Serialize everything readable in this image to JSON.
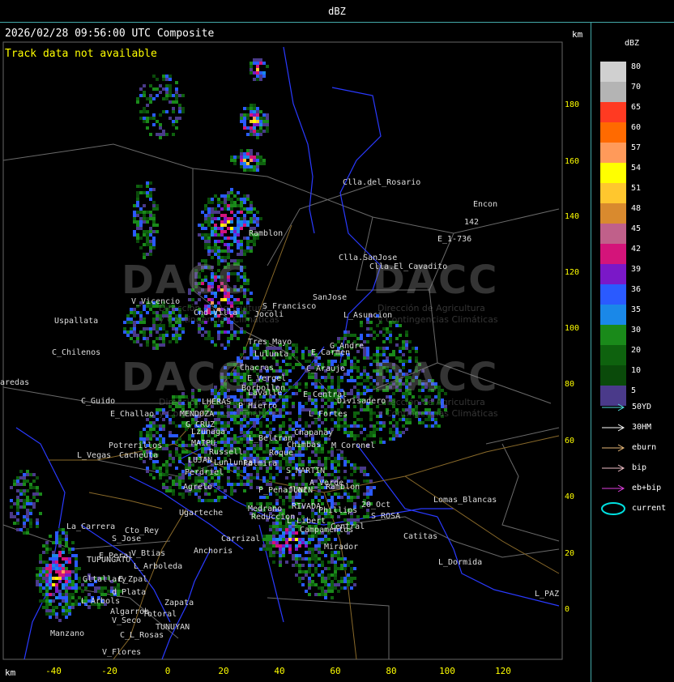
{
  "window_title": "dBZ",
  "header": {
    "timestamp": "2026/02/28 09:56:00 UTC Composite",
    "track_status": "Track data not available",
    "km_label_top": "km",
    "km_label_bottom": "km"
  },
  "axes": {
    "y_ticks": [
      "180",
      "160",
      "140",
      "120",
      "100",
      "80",
      "60",
      "40",
      "20",
      "0"
    ],
    "x_ticks": [
      "-40",
      "-20",
      "0",
      "20",
      "40",
      "60",
      "80",
      "100",
      "120"
    ]
  },
  "legend": {
    "title": "dBZ",
    "entries": [
      {
        "label": "80",
        "color": "#d0d0d0"
      },
      {
        "label": "70",
        "color": "#b4b4b4"
      },
      {
        "label": "65",
        "color": "#ff3a22"
      },
      {
        "label": "60",
        "color": "#ff6a00"
      },
      {
        "label": "57",
        "color": "#ff9a5a"
      },
      {
        "label": "54",
        "color": "#ffff00"
      },
      {
        "label": "51",
        "color": "#ffc72e"
      },
      {
        "label": "48",
        "color": "#d98a2e"
      },
      {
        "label": "45",
        "color": "#c0608a"
      },
      {
        "label": "42",
        "color": "#d4147a"
      },
      {
        "label": "39",
        "color": "#7a18c8"
      },
      {
        "label": "36",
        "color": "#2a5aff"
      },
      {
        "label": "35",
        "color": "#1a88e8"
      },
      {
        "label": "30",
        "color": "#1a8a1a"
      },
      {
        "label": "20",
        "color": "#0e620e"
      },
      {
        "label": "10",
        "color": "#0a4a0a"
      },
      {
        "label": "5",
        "color": "#4a3a8a"
      }
    ],
    "tracks": [
      {
        "label": "50YD",
        "color": "#55dddd"
      },
      {
        "label": "30HM",
        "color": "#ffffff"
      },
      {
        "label": "eburn",
        "color": "#e8b878"
      },
      {
        "label": "bip",
        "color": "#f0c0c8"
      },
      {
        "label": "eb+bip",
        "color": "#e040e0"
      },
      {
        "label": "current",
        "color": "#00e0e0"
      }
    ]
  },
  "watermark": {
    "brand": "DACC",
    "line1": "Dirección de Agricultura",
    "line2": "y Contingencias Climáticas"
  },
  "places": [
    {
      "name": "Clla.del_Rosario"
    },
    {
      "name": "Encon"
    },
    {
      "name": "142"
    },
    {
      "name": "E_1-736"
    },
    {
      "name": "Clla.SanJose"
    },
    {
      "name": "Clla.El_Cavadito"
    },
    {
      "name": "Ramblon"
    },
    {
      "name": "V_Vicencio"
    },
    {
      "name": "Cnd.Villa"
    },
    {
      "name": "S_Francisco"
    },
    {
      "name": "SanJose"
    },
    {
      "name": "Uspallata"
    },
    {
      "name": "Jocoli"
    },
    {
      "name": "L_Asuncion"
    },
    {
      "name": "Tres_Mayo"
    },
    {
      "name": "G_Andre"
    },
    {
      "name": "C_Chilenos"
    },
    {
      "name": "Lulunta"
    },
    {
      "name": "E_Carmen"
    },
    {
      "name": "aredas"
    },
    {
      "name": "Chacras"
    },
    {
      "name": "E_Vergel"
    },
    {
      "name": "C_Araujo"
    },
    {
      "name": "Borbollon"
    },
    {
      "name": "Lavalle"
    },
    {
      "name": "E_Central"
    },
    {
      "name": "C_Guido"
    },
    {
      "name": "LHERAS"
    },
    {
      "name": "P_Hierro"
    },
    {
      "name": "Divisadero"
    },
    {
      "name": "E_Challao"
    },
    {
      "name": "MENDOZA"
    },
    {
      "name": "L_Fortes"
    },
    {
      "name": "G_CRUZ"
    },
    {
      "name": "Chapanay"
    },
    {
      "name": "Lzunaga"
    },
    {
      "name": "L_Beltran"
    },
    {
      "name": "Potrerillos"
    },
    {
      "name": "MAIPU"
    },
    {
      "name": "Chimbas"
    },
    {
      "name": "M_Coronel"
    },
    {
      "name": "L_Vegas"
    },
    {
      "name": "Cacheuta"
    },
    {
      "name": "Russell"
    },
    {
      "name": "Roque"
    },
    {
      "name": "LUJAN"
    },
    {
      "name": "Lunlunta"
    },
    {
      "name": "Palmira"
    },
    {
      "name": "Perdriel"
    },
    {
      "name": "S_MARTIN"
    },
    {
      "name": "Agrelo"
    },
    {
      "name": "A_Verde"
    },
    {
      "name": "Ramblon"
    },
    {
      "name": "P_Penaflor"
    },
    {
      "name": "JUNIN"
    },
    {
      "name": "Lomas_Blancas"
    },
    {
      "name": "Medrano"
    },
    {
      "name": "RIVADA"
    },
    {
      "name": "Phillips"
    },
    {
      "name": "Ugarteche"
    },
    {
      "name": "Reduccion"
    },
    {
      "name": "L_Libert"
    },
    {
      "name": "20_Oct"
    },
    {
      "name": "S_ROSA"
    },
    {
      "name": "La_Carrera"
    },
    {
      "name": "Cto_Rey"
    },
    {
      "name": "S_Jose"
    },
    {
      "name": "Carrizal"
    },
    {
      "name": "Central"
    },
    {
      "name": "Catitas"
    },
    {
      "name": "E_Peral"
    },
    {
      "name": "V_Btias"
    },
    {
      "name": "Anchoris"
    },
    {
      "name": "Campamentos"
    },
    {
      "name": "TUPUNGATO"
    },
    {
      "name": "Mirador"
    },
    {
      "name": "L_Dormida"
    },
    {
      "name": "L_Arboleda"
    },
    {
      "name": "Gltallary"
    },
    {
      "name": "E_Zpal"
    },
    {
      "name": "d_Plata"
    },
    {
      "name": "L_Arbols"
    },
    {
      "name": "Zapata"
    },
    {
      "name": "L_PAZ"
    },
    {
      "name": "Algarrob"
    },
    {
      "name": "V_Seco"
    },
    {
      "name": "Totoral"
    },
    {
      "name": "TUNUYAN"
    },
    {
      "name": "Manzano"
    },
    {
      "name": "C_L_Rosas"
    },
    {
      "name": "V_Flores"
    }
  ]
}
